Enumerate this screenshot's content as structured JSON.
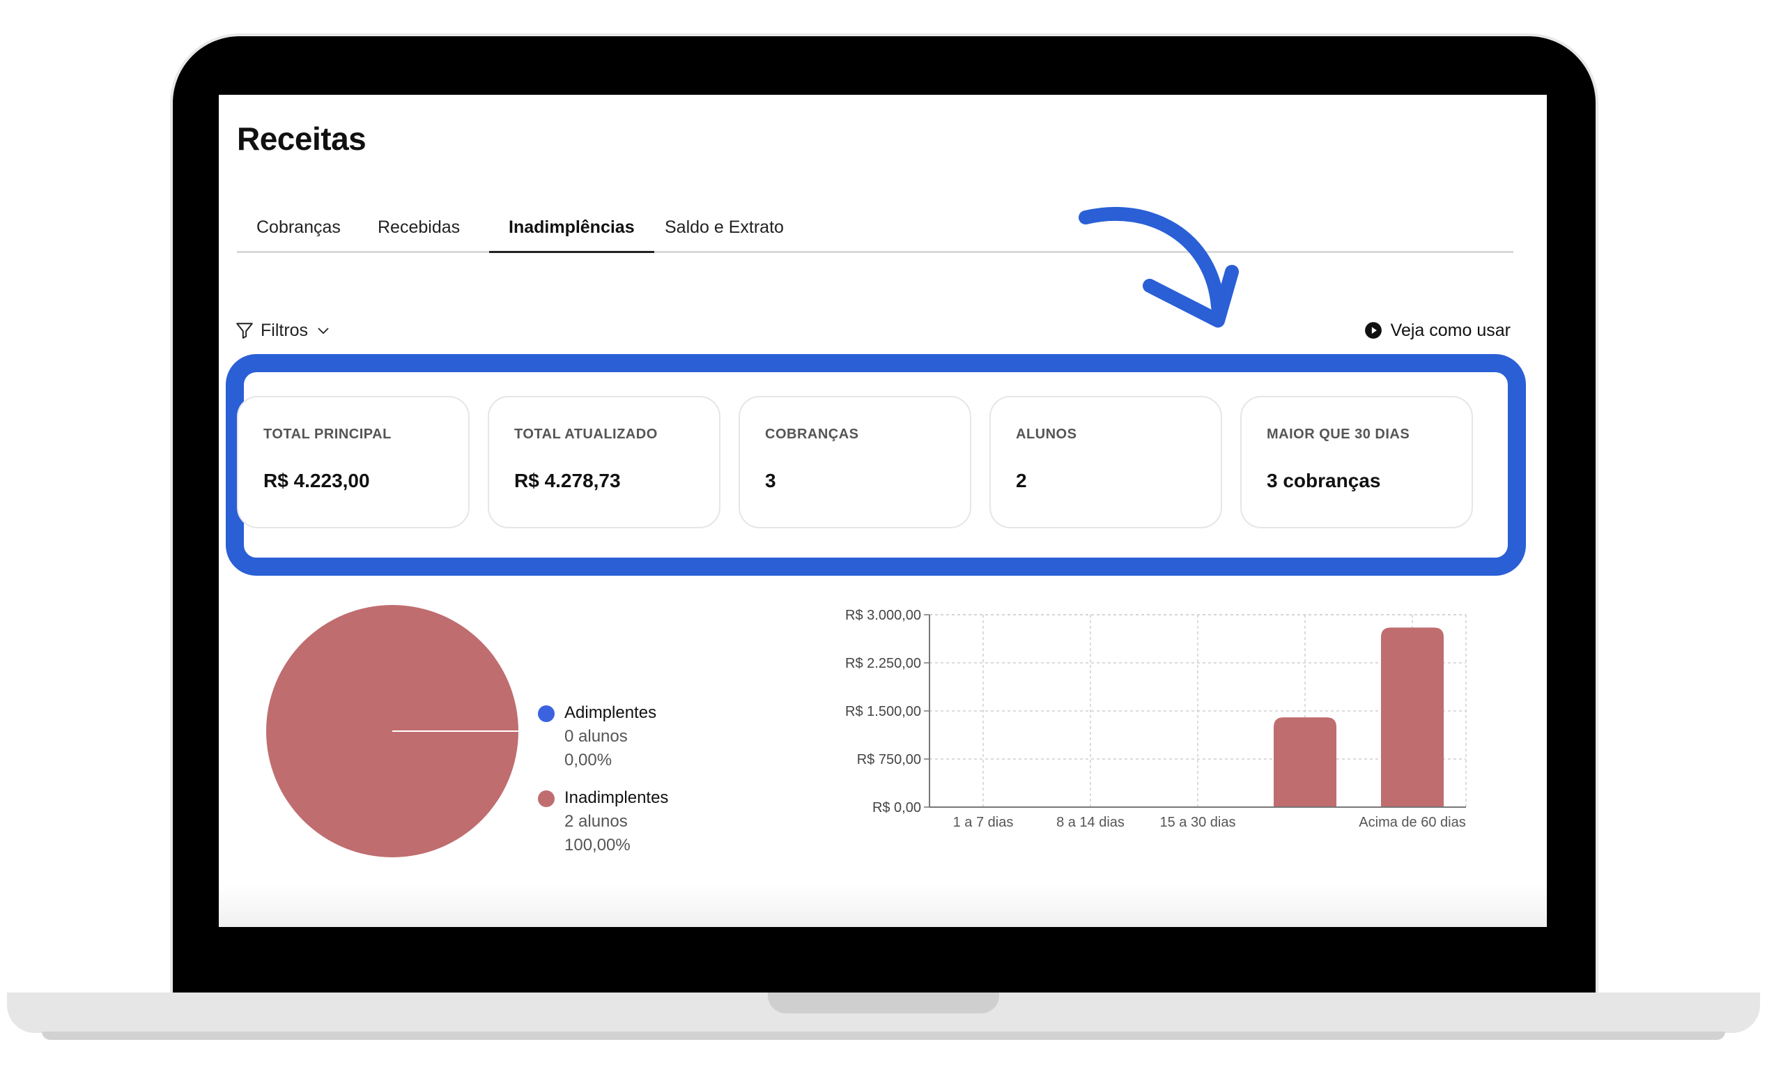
{
  "page": {
    "title": "Receitas"
  },
  "tabs": [
    {
      "label": "Cobranças"
    },
    {
      "label": "Recebidas"
    },
    {
      "label": "Inadimplências"
    },
    {
      "label": "Saldo e Extrato"
    }
  ],
  "filters": {
    "label": "Filtros"
  },
  "help": {
    "label": "Veja como usar"
  },
  "cards": [
    {
      "label": "TOTAL PRINCIPAL",
      "value": "R$ 4.223,00"
    },
    {
      "label": "TOTAL ATUALIZADO",
      "value": "R$ 4.278,73"
    },
    {
      "label": "COBRANÇAS",
      "value": "3"
    },
    {
      "label": "ALUNOS",
      "value": "2"
    },
    {
      "label": "MAIOR QUE 30 DIAS",
      "value": "3 cobranças"
    }
  ],
  "colors": {
    "accent": "#2a5fd6",
    "adimplentes": "#3b63e0",
    "inadimplentes": "#bf6d6f"
  },
  "legend": [
    {
      "name": "Adimplentes",
      "count": "0 alunos",
      "percent": "0,00%"
    },
    {
      "name": "Inadimplentes",
      "count": "2 alunos",
      "percent": "100,00%"
    }
  ],
  "chart_data": [
    {
      "type": "pie",
      "categories": [
        "Adimplentes",
        "Inadimplentes"
      ],
      "values": [
        0,
        100
      ],
      "unit": "%"
    },
    {
      "type": "bar",
      "categories": [
        "1 a 7 dias",
        "8 a 14 dias",
        "15 a 30 dias",
        "",
        "Acima de 60 dias"
      ],
      "values": [
        0,
        0,
        0,
        1400,
        2800
      ],
      "ylim": [
        0,
        3000
      ],
      "yticks": [
        0,
        750,
        1500,
        2250,
        3000
      ],
      "ytick_labels": [
        "R$ 0,00",
        "R$ 750,00",
        "R$ 1.500,00",
        "R$ 2.250,00",
        "R$ 3.000,00"
      ],
      "grid": true
    }
  ]
}
